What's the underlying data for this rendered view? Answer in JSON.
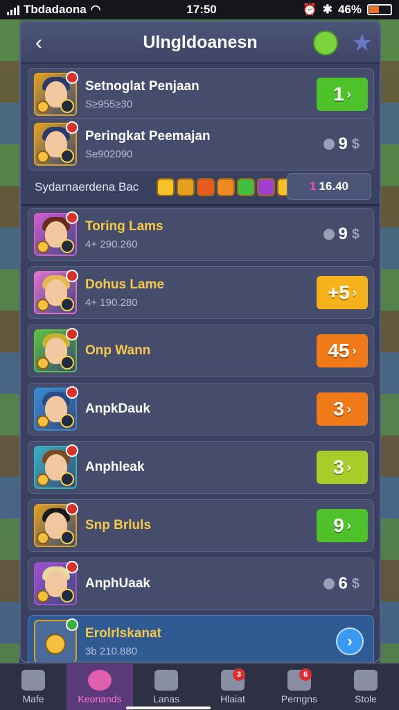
{
  "status": {
    "carrier": "Tbdadaona",
    "time": "17:50",
    "battery": "46%",
    "battery_level": 0.46
  },
  "header": {
    "title": "Ulngldoanesn"
  },
  "top_rows": [
    {
      "name": "Setnoglat Penjaan",
      "sub": "S≥955≥30",
      "score": "1",
      "style": "green"
    },
    {
      "name": "Peringkat Peemajan",
      "sub": "Se902090",
      "score": "9",
      "style": "plain"
    }
  ],
  "achievement": {
    "label": "Sydarnaerdena Bac",
    "value": "1",
    "value_rest": "16.40"
  },
  "rows": [
    {
      "name": "Toring Lams",
      "sub": "4+ 290.260",
      "score": "9",
      "style": "plain",
      "gold": true,
      "hair": "#6a2a20",
      "border": "#d05cd0"
    },
    {
      "name": "Dohus Lame",
      "sub": "4+ 190.280",
      "score": "+5",
      "style": "yellow",
      "gold": true,
      "hair": "#e8b850",
      "border": "#e070d0"
    },
    {
      "name": "Onp Wann",
      "sub": "",
      "score": "45",
      "style": "orange",
      "gold": true,
      "hair": "#c8b030",
      "border": "#60c040"
    },
    {
      "name": "AnpkDauk",
      "sub": "",
      "score": "3",
      "style": "orange",
      "gold": false,
      "hair": "#2a4a8a",
      "border": "#3a8ad0"
    },
    {
      "name": "Anphleak",
      "sub": "",
      "score": "3",
      "style": "lime",
      "gold": false,
      "hair": "#7a4a20",
      "border": "#3ab0c0"
    },
    {
      "name": "Snp Brluls",
      "sub": "",
      "score": "9",
      "style": "green",
      "gold": true,
      "hair": "#1a1a1a",
      "border": "#e0a020"
    },
    {
      "name": "AnphUaak",
      "sub": "",
      "score": "6",
      "style": "plain",
      "gold": false,
      "hair": "#e8d8a0",
      "border": "#a050d0"
    }
  ],
  "featured": {
    "name": "Erolrlskanat",
    "sub": "3b 210.880"
  },
  "nav": [
    {
      "label": "Mafe",
      "badge": ""
    },
    {
      "label": "Keonands",
      "badge": ""
    },
    {
      "label": "Lanas",
      "badge": ""
    },
    {
      "label": "Hlaiat",
      "badge": "3"
    },
    {
      "label": "Perngns",
      "badge": "6"
    },
    {
      "label": "Stole",
      "badge": ""
    }
  ],
  "colors": {
    "green": "#4fc12a",
    "yellow": "#f5b21a",
    "orange": "#f07a1a",
    "lime": "#a8cc2a",
    "blue": "#2a7ad8",
    "panel": "#3a4160"
  }
}
